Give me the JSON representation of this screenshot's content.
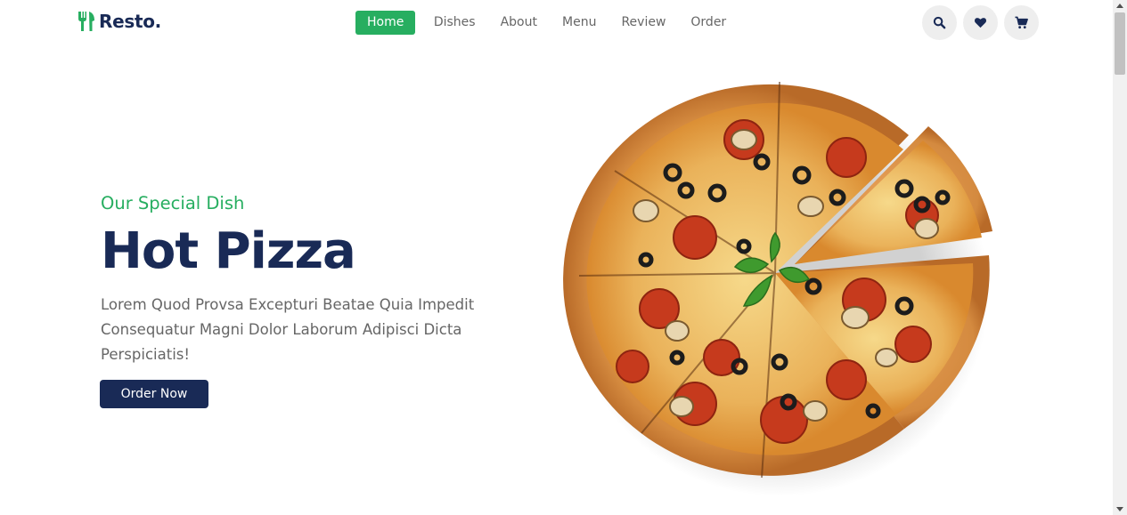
{
  "brand": {
    "name": "Resto.",
    "icon": "fork-knife-icon",
    "accent": "#27ae60",
    "dark": "#192a56"
  },
  "nav": {
    "items": [
      {
        "label": "Home",
        "active": true
      },
      {
        "label": "Dishes",
        "active": false
      },
      {
        "label": "About",
        "active": false
      },
      {
        "label": "Menu",
        "active": false
      },
      {
        "label": "Review",
        "active": false
      },
      {
        "label": "Order",
        "active": false
      }
    ]
  },
  "header_icons": [
    "search-icon",
    "heart-icon",
    "cart-icon"
  ],
  "hero": {
    "subtitle": "Our Special Dish",
    "title": "Hot Pizza",
    "description": "Lorem Quod Provsa Excepturi Beatae Quia Impedit Consequatur Magni Dolor Laborum Adipisci Dicta Perspiciatis!",
    "cta_label": "Order Now",
    "image": "pizza-image"
  }
}
